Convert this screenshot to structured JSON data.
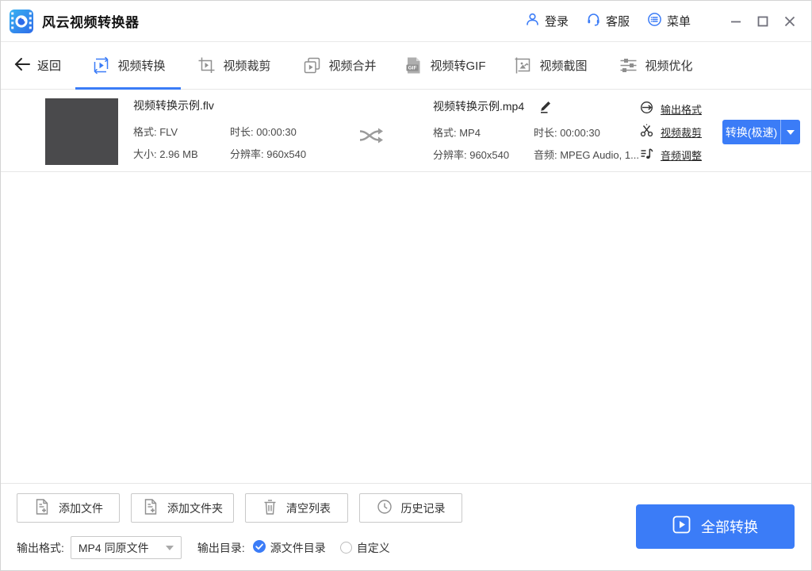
{
  "window": {
    "title": "风云视频转换器",
    "login": "登录",
    "support": "客服",
    "menu": "菜单"
  },
  "nav": {
    "back": "返回",
    "tabs": [
      {
        "label": "视频转换",
        "active": true
      },
      {
        "label": "视频裁剪",
        "active": false
      },
      {
        "label": "视频合并",
        "active": false
      },
      {
        "label": "视频转GIF",
        "active": false
      },
      {
        "label": "视频截图",
        "active": false
      },
      {
        "label": "视频优化",
        "active": false
      }
    ]
  },
  "file": {
    "source": {
      "name": "视频转换示例.flv",
      "format": "格式: FLV",
      "duration": "时长: 00:00:30",
      "size": "大小: 2.96 MB",
      "resolution": "分辨率: 960x540"
    },
    "output": {
      "name": "视频转换示例.mp4",
      "format": "格式: MP4",
      "duration": "时长: 00:00:30",
      "resolution": "分辨率: 960x540",
      "audio": "音频: MPEG Audio, 1..."
    },
    "actions": {
      "output_format": "输出格式",
      "video_crop": "视频裁剪",
      "audio_adjust": "音频调整"
    },
    "convert": "转换(极速)"
  },
  "footer": {
    "add_file": "添加文件",
    "add_folder": "添加文件夹",
    "clear_list": "清空列表",
    "history": "历史记录",
    "output_format_label": "输出格式:",
    "format_value": "MP4 同原文件",
    "output_dir_label": "输出目录:",
    "dir_source": "源文件目录",
    "dir_custom": "自定义",
    "convert_all": "全部转换"
  },
  "icons": {
    "gif_label": "GIF",
    "app": "film-lens-icon",
    "login": "person-icon",
    "support": "headset-icon",
    "menu": "circle-list-icon",
    "shuffle": "shuffle-arrows-icon",
    "edit": "pencil-icon"
  },
  "colors": {
    "accent": "#3b7cf7",
    "thumbnail": "#4a4a4c",
    "border": "#e6e6e6",
    "gray_icon": "#8f8f8f",
    "text": "#262626"
  }
}
